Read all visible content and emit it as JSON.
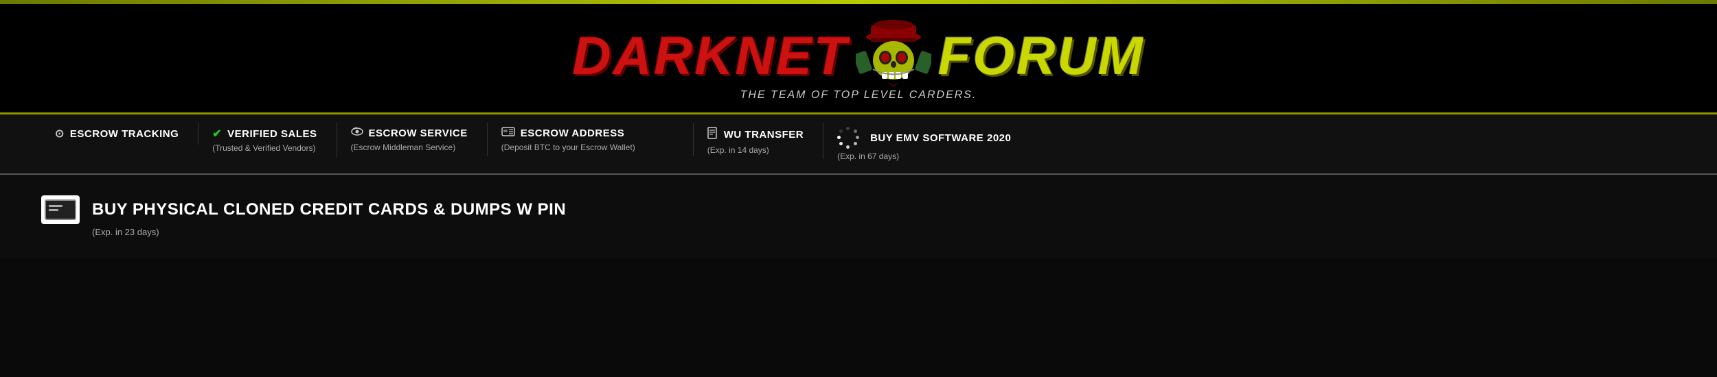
{
  "accent": {
    "color": "#b8cc00"
  },
  "header": {
    "logo_left": "DARKNET",
    "logo_right": "FORUM",
    "subtitle": "THE TEAM OF TOP LEVEL CARDERS."
  },
  "navbar": {
    "items": [
      {
        "id": "escrow-tracking",
        "icon": "globe",
        "title": "ESCROW TRACKING",
        "subtitle": ""
      },
      {
        "id": "verified-sales",
        "icon": "check",
        "title": "VERIFIED SALES",
        "subtitle": "(Trusted & Verified Vendors)"
      },
      {
        "id": "escrow-service",
        "icon": "eye",
        "title": "ESCROW SERVICE",
        "subtitle": "(Escrow Middleman Service)"
      },
      {
        "id": "escrow-address",
        "icon": "id-card",
        "title": "ESCROW ADDRESS",
        "subtitle": "(Deposit BTC to your Escrow Wallet)"
      },
      {
        "id": "wu-transfer",
        "icon": "doc",
        "title": "WU TRANSFER",
        "subtitle": "(Exp. in 14 days)"
      },
      {
        "id": "buy-emv",
        "icon": "spinner",
        "title": "BUY EMV SOFTWARE 2020",
        "subtitle": "(Exp. in 67 days)"
      }
    ]
  },
  "promo": {
    "icon": "credit-card",
    "title": "BUY PHYSICAL CLONED CREDIT CARDS & DUMPS W PIN",
    "subtitle": "(Exp. in 23 days)"
  }
}
